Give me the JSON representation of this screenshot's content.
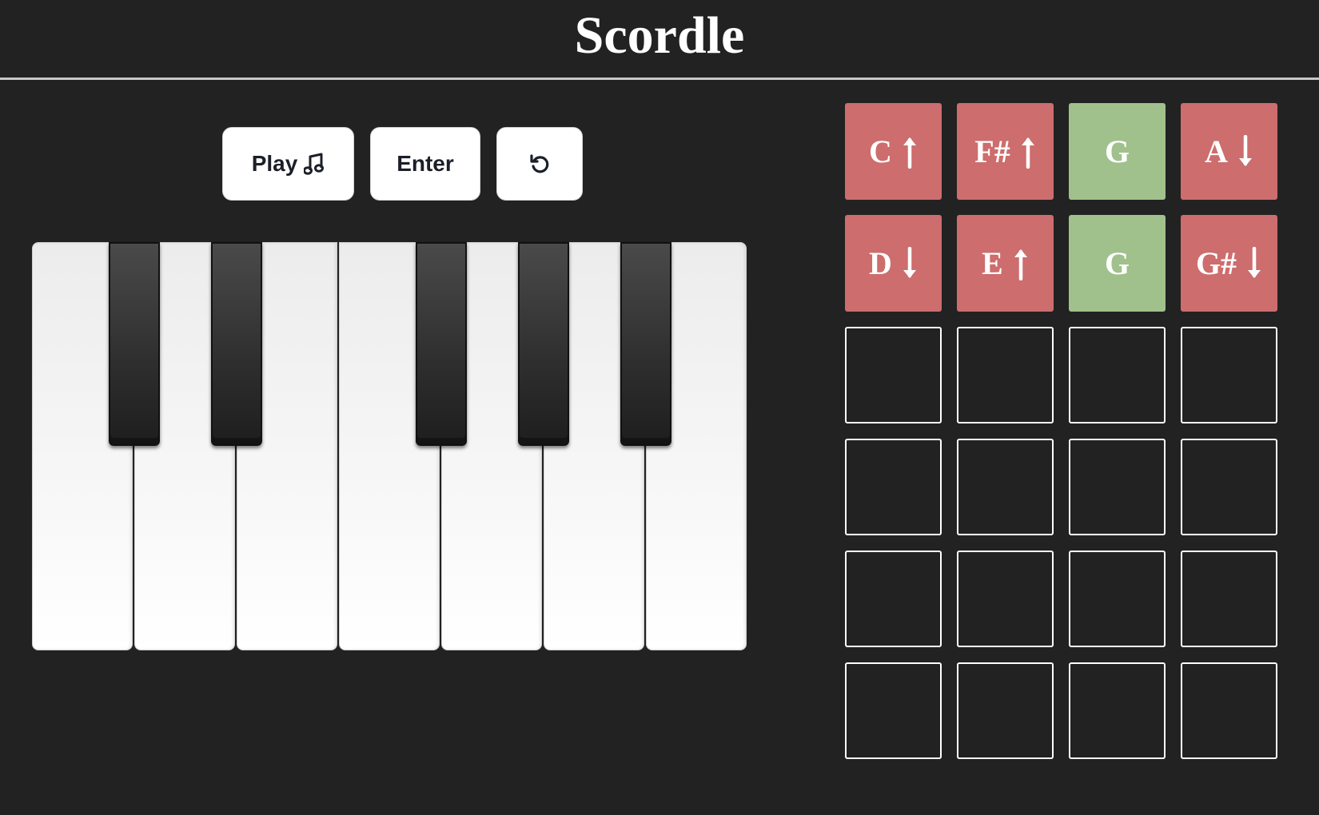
{
  "header": {
    "title": "Scordle"
  },
  "controls": {
    "play_label": "Play",
    "play_icon": "music-note-icon",
    "enter_label": "Enter",
    "reset_icon": "reset-icon"
  },
  "piano": {
    "white_keys": 7,
    "black_keys": 5
  },
  "colors": {
    "background": "#222222",
    "wrong": "#cd6d6d",
    "correct": "#a0c18c",
    "tile_border": "#ffffff"
  },
  "board": {
    "rows": [
      [
        {
          "note": "C",
          "status": "wrong",
          "hint": "up"
        },
        {
          "note": "F#",
          "status": "wrong",
          "hint": "up"
        },
        {
          "note": "G",
          "status": "correct",
          "hint": ""
        },
        {
          "note": "A",
          "status": "wrong",
          "hint": "down"
        }
      ],
      [
        {
          "note": "D",
          "status": "wrong",
          "hint": "down"
        },
        {
          "note": "E",
          "status": "wrong",
          "hint": "up"
        },
        {
          "note": "G",
          "status": "correct",
          "hint": ""
        },
        {
          "note": "G#",
          "status": "wrong",
          "hint": "down"
        }
      ],
      [
        {
          "note": ""
        },
        {
          "note": ""
        },
        {
          "note": ""
        },
        {
          "note": ""
        }
      ],
      [
        {
          "note": ""
        },
        {
          "note": ""
        },
        {
          "note": ""
        },
        {
          "note": ""
        }
      ],
      [
        {
          "note": ""
        },
        {
          "note": ""
        },
        {
          "note": ""
        },
        {
          "note": ""
        }
      ],
      [
        {
          "note": ""
        },
        {
          "note": ""
        },
        {
          "note": ""
        },
        {
          "note": ""
        }
      ]
    ]
  }
}
